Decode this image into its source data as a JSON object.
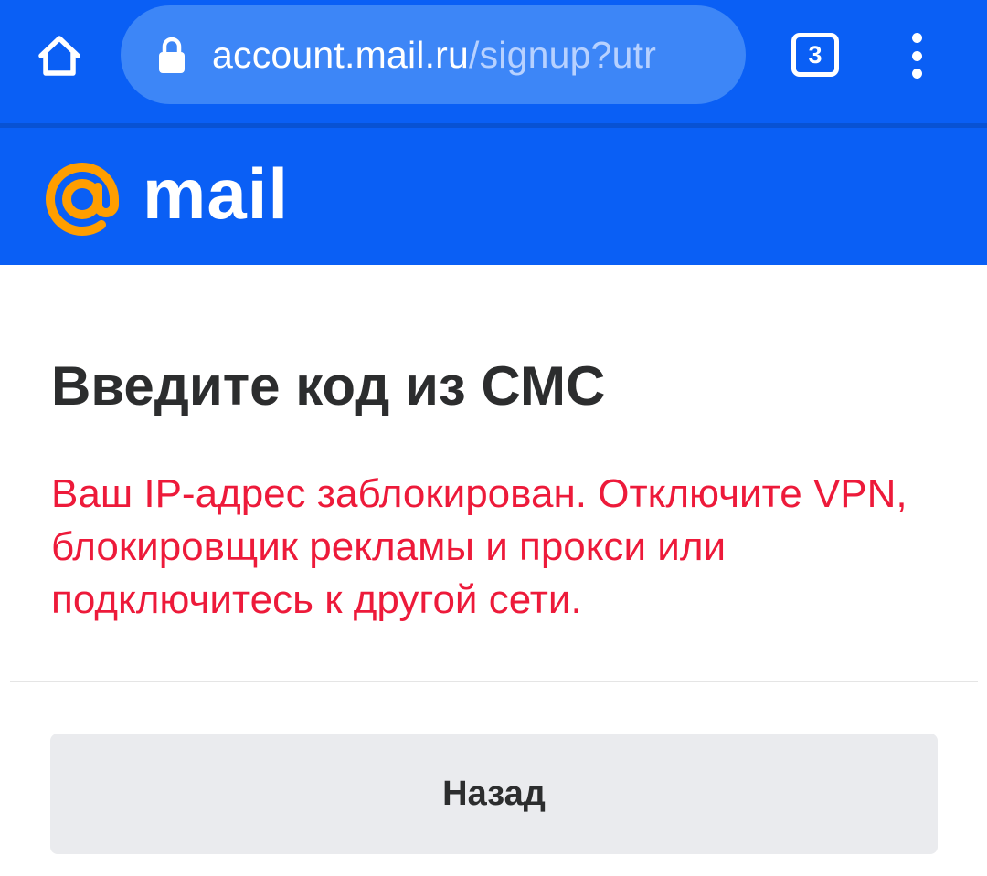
{
  "browser": {
    "url_host": "account.mail.ru",
    "url_path": "/signup?utr",
    "tab_count": "3",
    "icons": {
      "home": "home-icon",
      "lock": "lock-icon",
      "menu": "more-vertical-icon"
    },
    "bar_color": "#0a5ff5"
  },
  "header": {
    "logo_text": "mail",
    "logo_icon": "at-sign-logo",
    "logo_accent_color": "#ff9e00"
  },
  "main": {
    "title": "Введите код из СМС",
    "error_message": "Ваш IP-адрес заблокирован. Отключите VPN, блокировщик рекламы и прокси или подключитесь к другой сети.",
    "error_color": "#ed1a3a",
    "back_button_label": "Назад"
  }
}
